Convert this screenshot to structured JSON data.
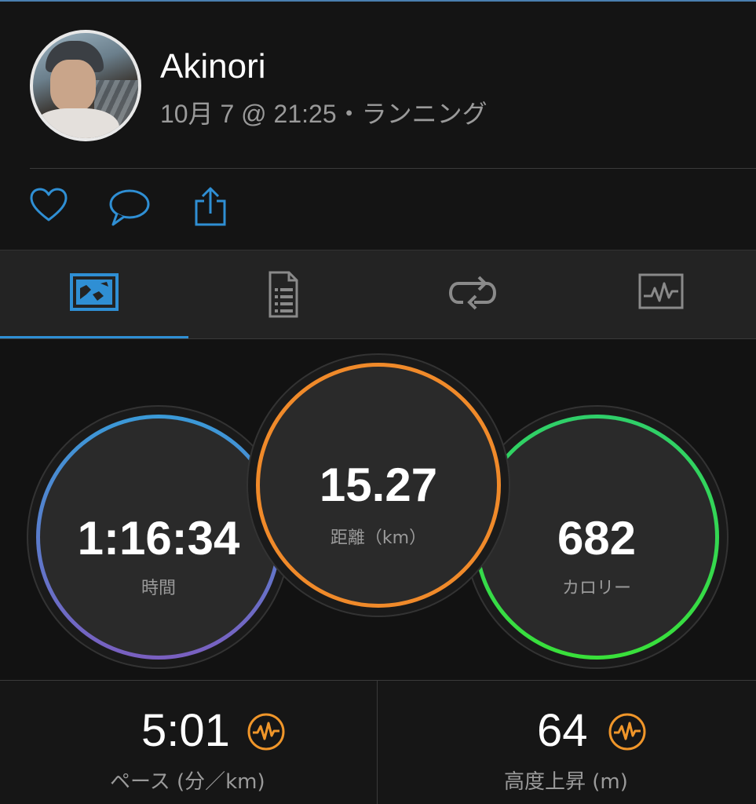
{
  "profile": {
    "name": "Akinori",
    "subline": "10月 7 @ 21:25・ランニング"
  },
  "actions": {
    "like_icon": "heart-icon",
    "comment_icon": "speech-bubble-icon",
    "share_icon": "share-icon"
  },
  "tabs": [
    {
      "icon": "map-icon",
      "active": true
    },
    {
      "icon": "document-list-icon",
      "active": false
    },
    {
      "icon": "laps-repeat-icon",
      "active": false
    },
    {
      "icon": "chart-icon",
      "active": false
    }
  ],
  "circles": {
    "time": {
      "value": "1:16:34",
      "label": "時間"
    },
    "distance": {
      "value": "15.27",
      "label": "距離（km）"
    },
    "calories": {
      "value": "682",
      "label": "カロリー"
    }
  },
  "stats": {
    "pace": {
      "value": "5:01",
      "label": "ペース (分／km)"
    },
    "elevation": {
      "value": "64",
      "label": "高度上昇 (m)"
    }
  },
  "colors": {
    "accent_blue": "#2f8fd4",
    "time_ring_start": "#3a9ad8",
    "time_ring_end": "#7a5fc0",
    "distance_ring": "#f08a2a",
    "calories_ring": "#39e03a",
    "stat_icon": "#f0962a"
  }
}
